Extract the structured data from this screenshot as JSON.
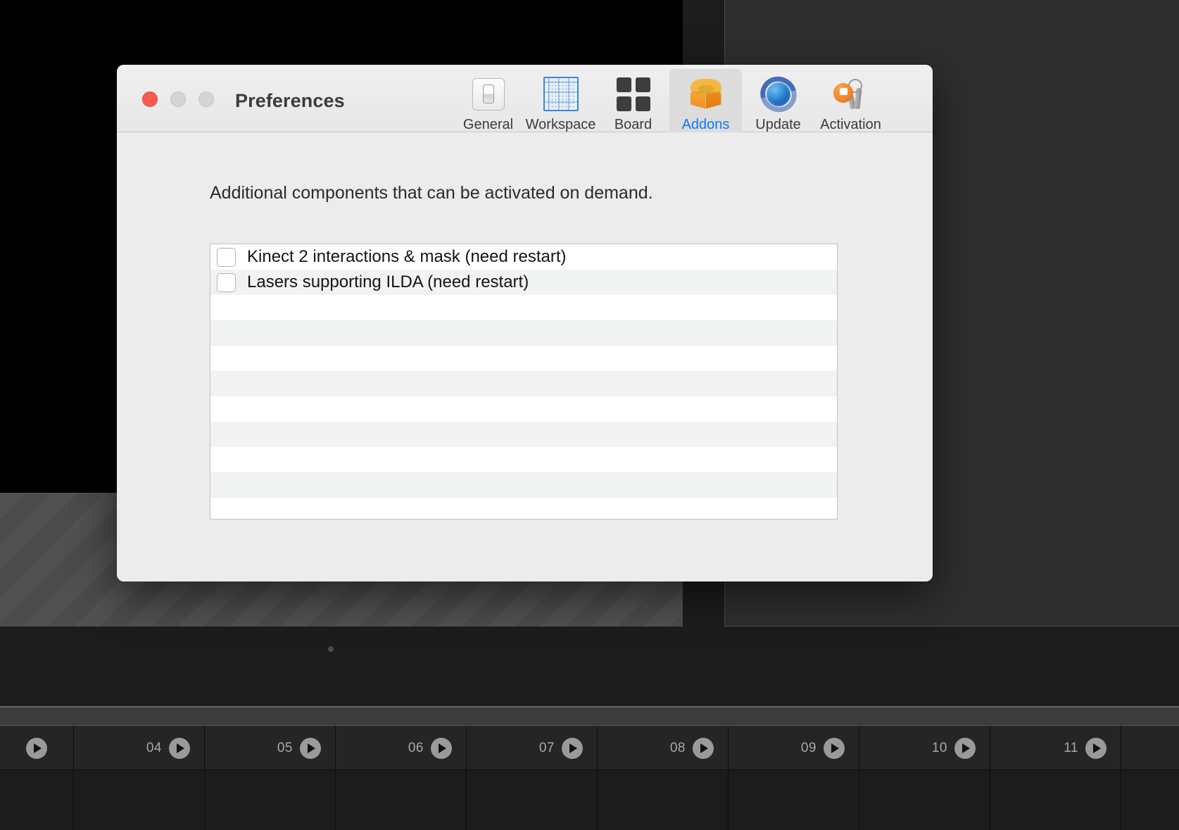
{
  "window": {
    "title": "Preferences",
    "traffic_lights": [
      {
        "name": "close",
        "color": "#f75b51"
      },
      {
        "name": "minimize",
        "color": "#d4d4d4"
      },
      {
        "name": "zoom",
        "color": "#d4d4d4"
      }
    ]
  },
  "toolbar": {
    "selected": "Addons",
    "accent_color": "#1278f5",
    "items": [
      {
        "label": "General",
        "icon": "toggle-switch-icon",
        "selected": false
      },
      {
        "label": "Workspace",
        "icon": "dotted-grid-icon",
        "selected": false
      },
      {
        "label": "Board",
        "icon": "four-squares-icon",
        "selected": false
      },
      {
        "label": "Addons",
        "icon": "orange-box-icon",
        "selected": true
      },
      {
        "label": "Update",
        "icon": "globe-refresh-icon",
        "selected": false
      },
      {
        "label": "Activation",
        "icon": "keychain-lock-icon",
        "selected": false
      }
    ]
  },
  "content": {
    "description": "Additional components that can be activated on demand.",
    "addons": [
      {
        "label": "Kinect 2 interactions & mask   (need restart)",
        "checked": false
      },
      {
        "label": "Lasers supporting ILDA   (need restart)",
        "checked": false
      }
    ],
    "empty_rows": 10
  },
  "timeline": {
    "cells": [
      {
        "number": "",
        "first": true
      },
      {
        "number": "04",
        "first": false
      },
      {
        "number": "05",
        "first": false
      },
      {
        "number": "06",
        "first": false
      },
      {
        "number": "07",
        "first": false
      },
      {
        "number": "08",
        "first": false
      },
      {
        "number": "09",
        "first": false
      },
      {
        "number": "10",
        "first": false
      },
      {
        "number": "11",
        "first": false
      }
    ]
  }
}
